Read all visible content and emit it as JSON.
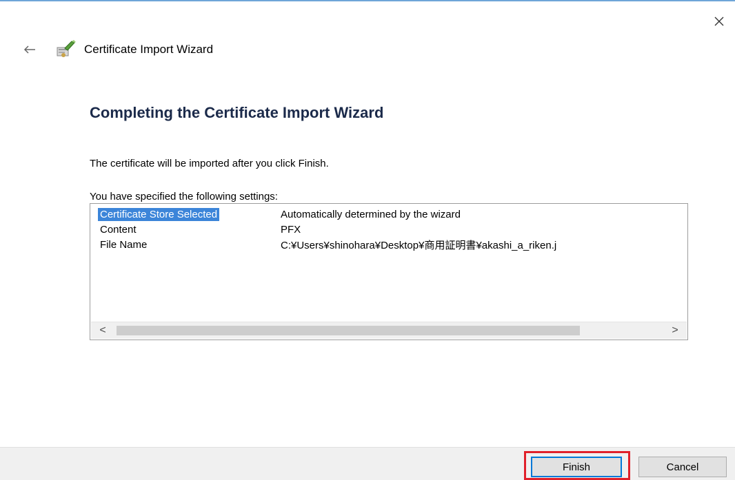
{
  "window": {
    "title": "Certificate Import Wizard",
    "close_icon": "close-icon",
    "back_icon": "back-arrow-icon",
    "app_icon": "certificate-wizard-icon"
  },
  "main": {
    "heading": "Completing the Certificate Import Wizard",
    "intro": "The certificate will be imported after you click Finish.",
    "settings_label": "You have specified the following settings:",
    "settings": [
      {
        "key": "Certificate Store Selected",
        "value": "Automatically determined by the wizard",
        "selected": true
      },
      {
        "key": "Content",
        "value": "PFX"
      },
      {
        "key": "File Name",
        "value": "C:¥Users¥shinohara¥Desktop¥商用証明書¥akashi_a_riken.j"
      }
    ],
    "scroll_left": "<",
    "scroll_right": ">"
  },
  "footer": {
    "finish_label": "Finish",
    "cancel_label": "Cancel"
  },
  "colors": {
    "selection": "#3c85d9",
    "highlight": "#e0202a",
    "heading": "#1b2a4a",
    "default_button_border": "#0078d7"
  }
}
